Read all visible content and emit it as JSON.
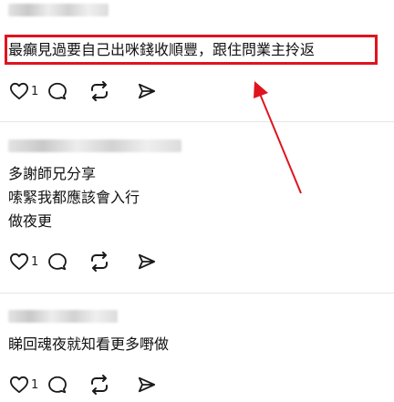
{
  "posts": [
    {
      "text_lines": [
        "最癲見過要自己出咪錢收順豐，跟住問業主拎返"
      ],
      "like_count": "1",
      "highlighted": true
    },
    {
      "text_lines": [
        "多謝師兄分享",
        "嗦緊我都應該會入行",
        "做夜更"
      ],
      "like_count": "1"
    },
    {
      "text_lines": [
        "睇回魂夜就知看更多嘢做"
      ],
      "like_count": "1"
    }
  ],
  "icons": {
    "like": "heart-icon",
    "reply": "comment-bubble-icon",
    "repost": "repost-icon",
    "share": "send-icon"
  },
  "colors": {
    "highlight": "#e0141e",
    "text": "#111111",
    "icon": "#1a1a1a",
    "divider": "#e6e6e6"
  }
}
